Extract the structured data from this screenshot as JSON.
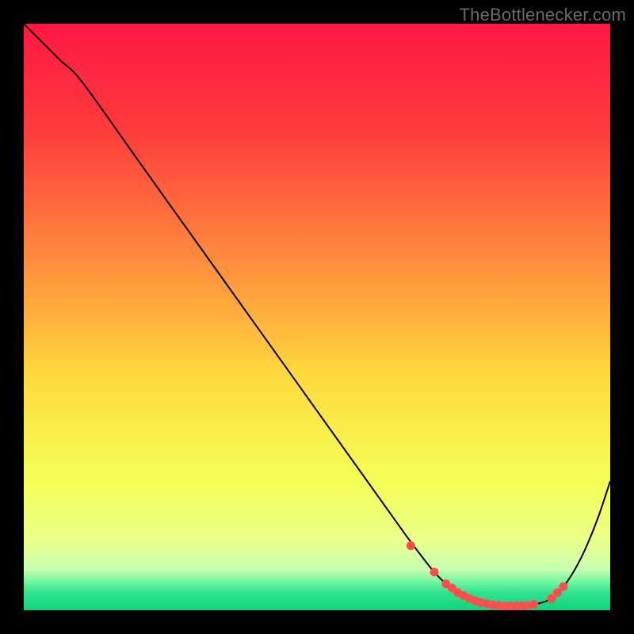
{
  "watermark": {
    "text": "TheBottlenecker.com"
  },
  "chart_data": {
    "type": "line",
    "title": "",
    "xlabel": "",
    "ylabel": "",
    "xlim": [
      0,
      100
    ],
    "ylim": [
      0,
      100
    ],
    "gradient_stops": [
      {
        "pos": 0,
        "color": "#ff1744"
      },
      {
        "pos": 18,
        "color": "#ff3b3b"
      },
      {
        "pos": 40,
        "color": "#ff8a3d"
      },
      {
        "pos": 60,
        "color": "#ffd93d"
      },
      {
        "pos": 78,
        "color": "#f4ff55"
      },
      {
        "pos": 88,
        "color": "#eaff8a"
      },
      {
        "pos": 93,
        "color": "#c9ffb0"
      },
      {
        "pos": 95,
        "color": "#78f7a0"
      },
      {
        "pos": 97,
        "color": "#2fe28f"
      },
      {
        "pos": 100,
        "color": "#0fd47a"
      }
    ],
    "series": [
      {
        "name": "bottleneck-curve",
        "x": [
          0,
          6,
          10,
          20,
          30,
          40,
          50,
          60,
          65,
          68,
          70,
          72,
          74,
          76,
          78,
          80,
          82,
          84,
          86,
          88,
          90,
          92,
          94,
          96,
          98,
          100
        ],
        "values": [
          100,
          94,
          90,
          76,
          62,
          48,
          34,
          20,
          13,
          9,
          6.5,
          4.5,
          3.0,
          2.0,
          1.3,
          0.9,
          0.7,
          0.7,
          0.8,
          1.2,
          2.0,
          4.0,
          7.0,
          11,
          16,
          22
        ]
      }
    ],
    "dots": {
      "name": "highlight-dots",
      "x": [
        66,
        70,
        72,
        73,
        74,
        75,
        76,
        77,
        78,
        79,
        80,
        81,
        82,
        83,
        84,
        85,
        86,
        87,
        90,
        91,
        92
      ],
      "values": [
        11,
        6.5,
        4.5,
        3.8,
        3.0,
        2.5,
        2.0,
        1.6,
        1.3,
        1.1,
        0.9,
        0.8,
        0.7,
        0.7,
        0.7,
        0.75,
        0.8,
        1.0,
        2.0,
        3.0,
        4.0
      ]
    }
  }
}
